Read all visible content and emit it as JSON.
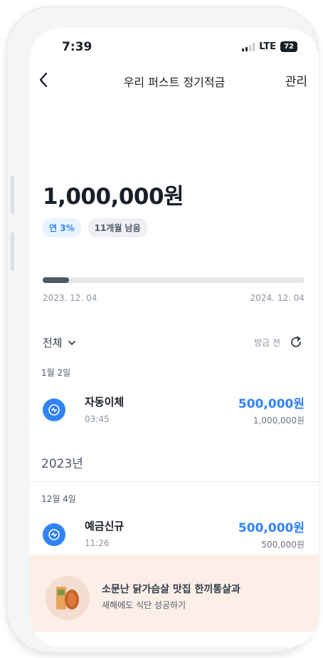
{
  "status": {
    "time": "7:39",
    "network": "LTE",
    "battery": "72"
  },
  "header": {
    "title": "우리 퍼스트 정기적금",
    "manage_label": "관리"
  },
  "account": {
    "balance": "1,000,000원",
    "rate_badge": "연 3%",
    "remaining_badge": "11개월 남음",
    "progress": 0.1,
    "start_date": "2023. 12. 04",
    "end_date": "2024. 12. 04"
  },
  "filter": {
    "label": "전체",
    "refresh_label": "방금 전"
  },
  "transactions": [
    {
      "date_header": "1월 2일",
      "title": "자동이체",
      "time": "03:45",
      "amount": "500,000원",
      "balance": "1,000,000원"
    },
    {
      "date_header": "12월 4일",
      "title": "예금신규",
      "time": "11:26",
      "amount": "500,000원",
      "balance": "500,000원"
    }
  ],
  "year_header": "2023년",
  "promo": {
    "title": "소문난 닭가슴살 맛집 한끼통살과",
    "subtitle": "새해에도 식단 성공하기"
  },
  "colors": {
    "accent": "#3182f6",
    "promo_bg": "#fcefe8",
    "progress": "#4e5968"
  }
}
